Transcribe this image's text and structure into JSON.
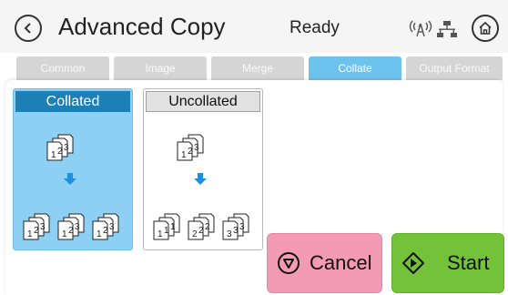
{
  "header": {
    "title": "Advanced Copy",
    "status": "Ready",
    "icons": [
      "back-icon",
      "wireless-icon",
      "network-icon",
      "home-icon"
    ]
  },
  "tabs": [
    {
      "label": "Common",
      "active": false
    },
    {
      "label": "Image",
      "active": false
    },
    {
      "label": "Merge",
      "active": false
    },
    {
      "label": "Collate",
      "active": true
    },
    {
      "label": "Output Format",
      "active": false
    }
  ],
  "options": [
    {
      "label": "Collated",
      "selected": true
    },
    {
      "label": "Uncollated",
      "selected": false
    }
  ],
  "buttons": {
    "cancel": "Cancel",
    "start": "Start"
  },
  "colors": {
    "tab_active": "#6cc3ee",
    "selected_option_bg": "#8dd0f3",
    "selected_label_bg": "#1c7fb6",
    "cancel_bg": "#f39ab6",
    "start_bg": "#74c23a",
    "arrow": "#1e90e0"
  }
}
